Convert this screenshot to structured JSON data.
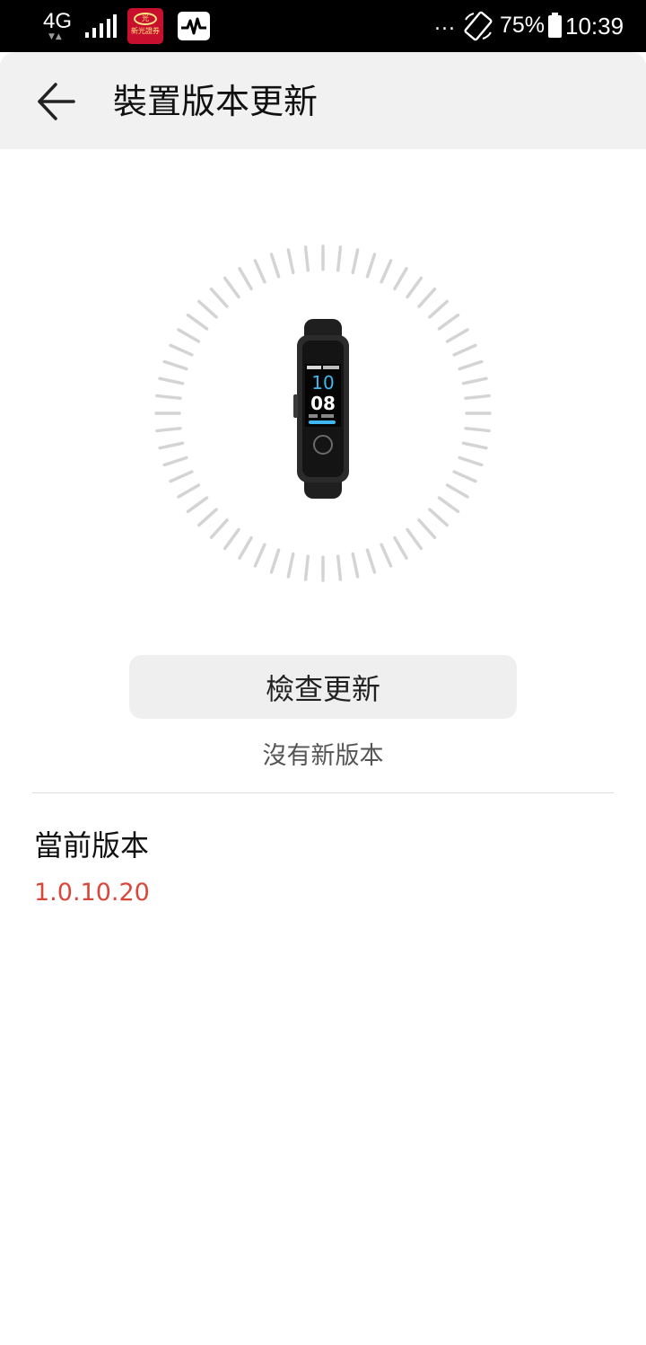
{
  "status_bar": {
    "network": "4G",
    "network_arrows": "▼▲",
    "app1_icon": "securities-app-icon",
    "app1_text": "新光證券",
    "app2_icon": "activity-app-icon",
    "dots": "...",
    "battery_percent": "75%",
    "time": "10:39"
  },
  "header": {
    "back_icon": "arrow-left-icon",
    "title": "裝置版本更新"
  },
  "device": {
    "icon": "smart-band",
    "screen_time_hour": "10",
    "screen_time_min": "08"
  },
  "main": {
    "check_button_label": "檢查更新",
    "status": "沒有新版本",
    "current_version_label": "當前版本",
    "current_version_value": "1.0.10.20"
  },
  "colors": {
    "accent": "#d8473a",
    "header_bg": "#f1f1f1",
    "button_bg": "#efefef"
  }
}
